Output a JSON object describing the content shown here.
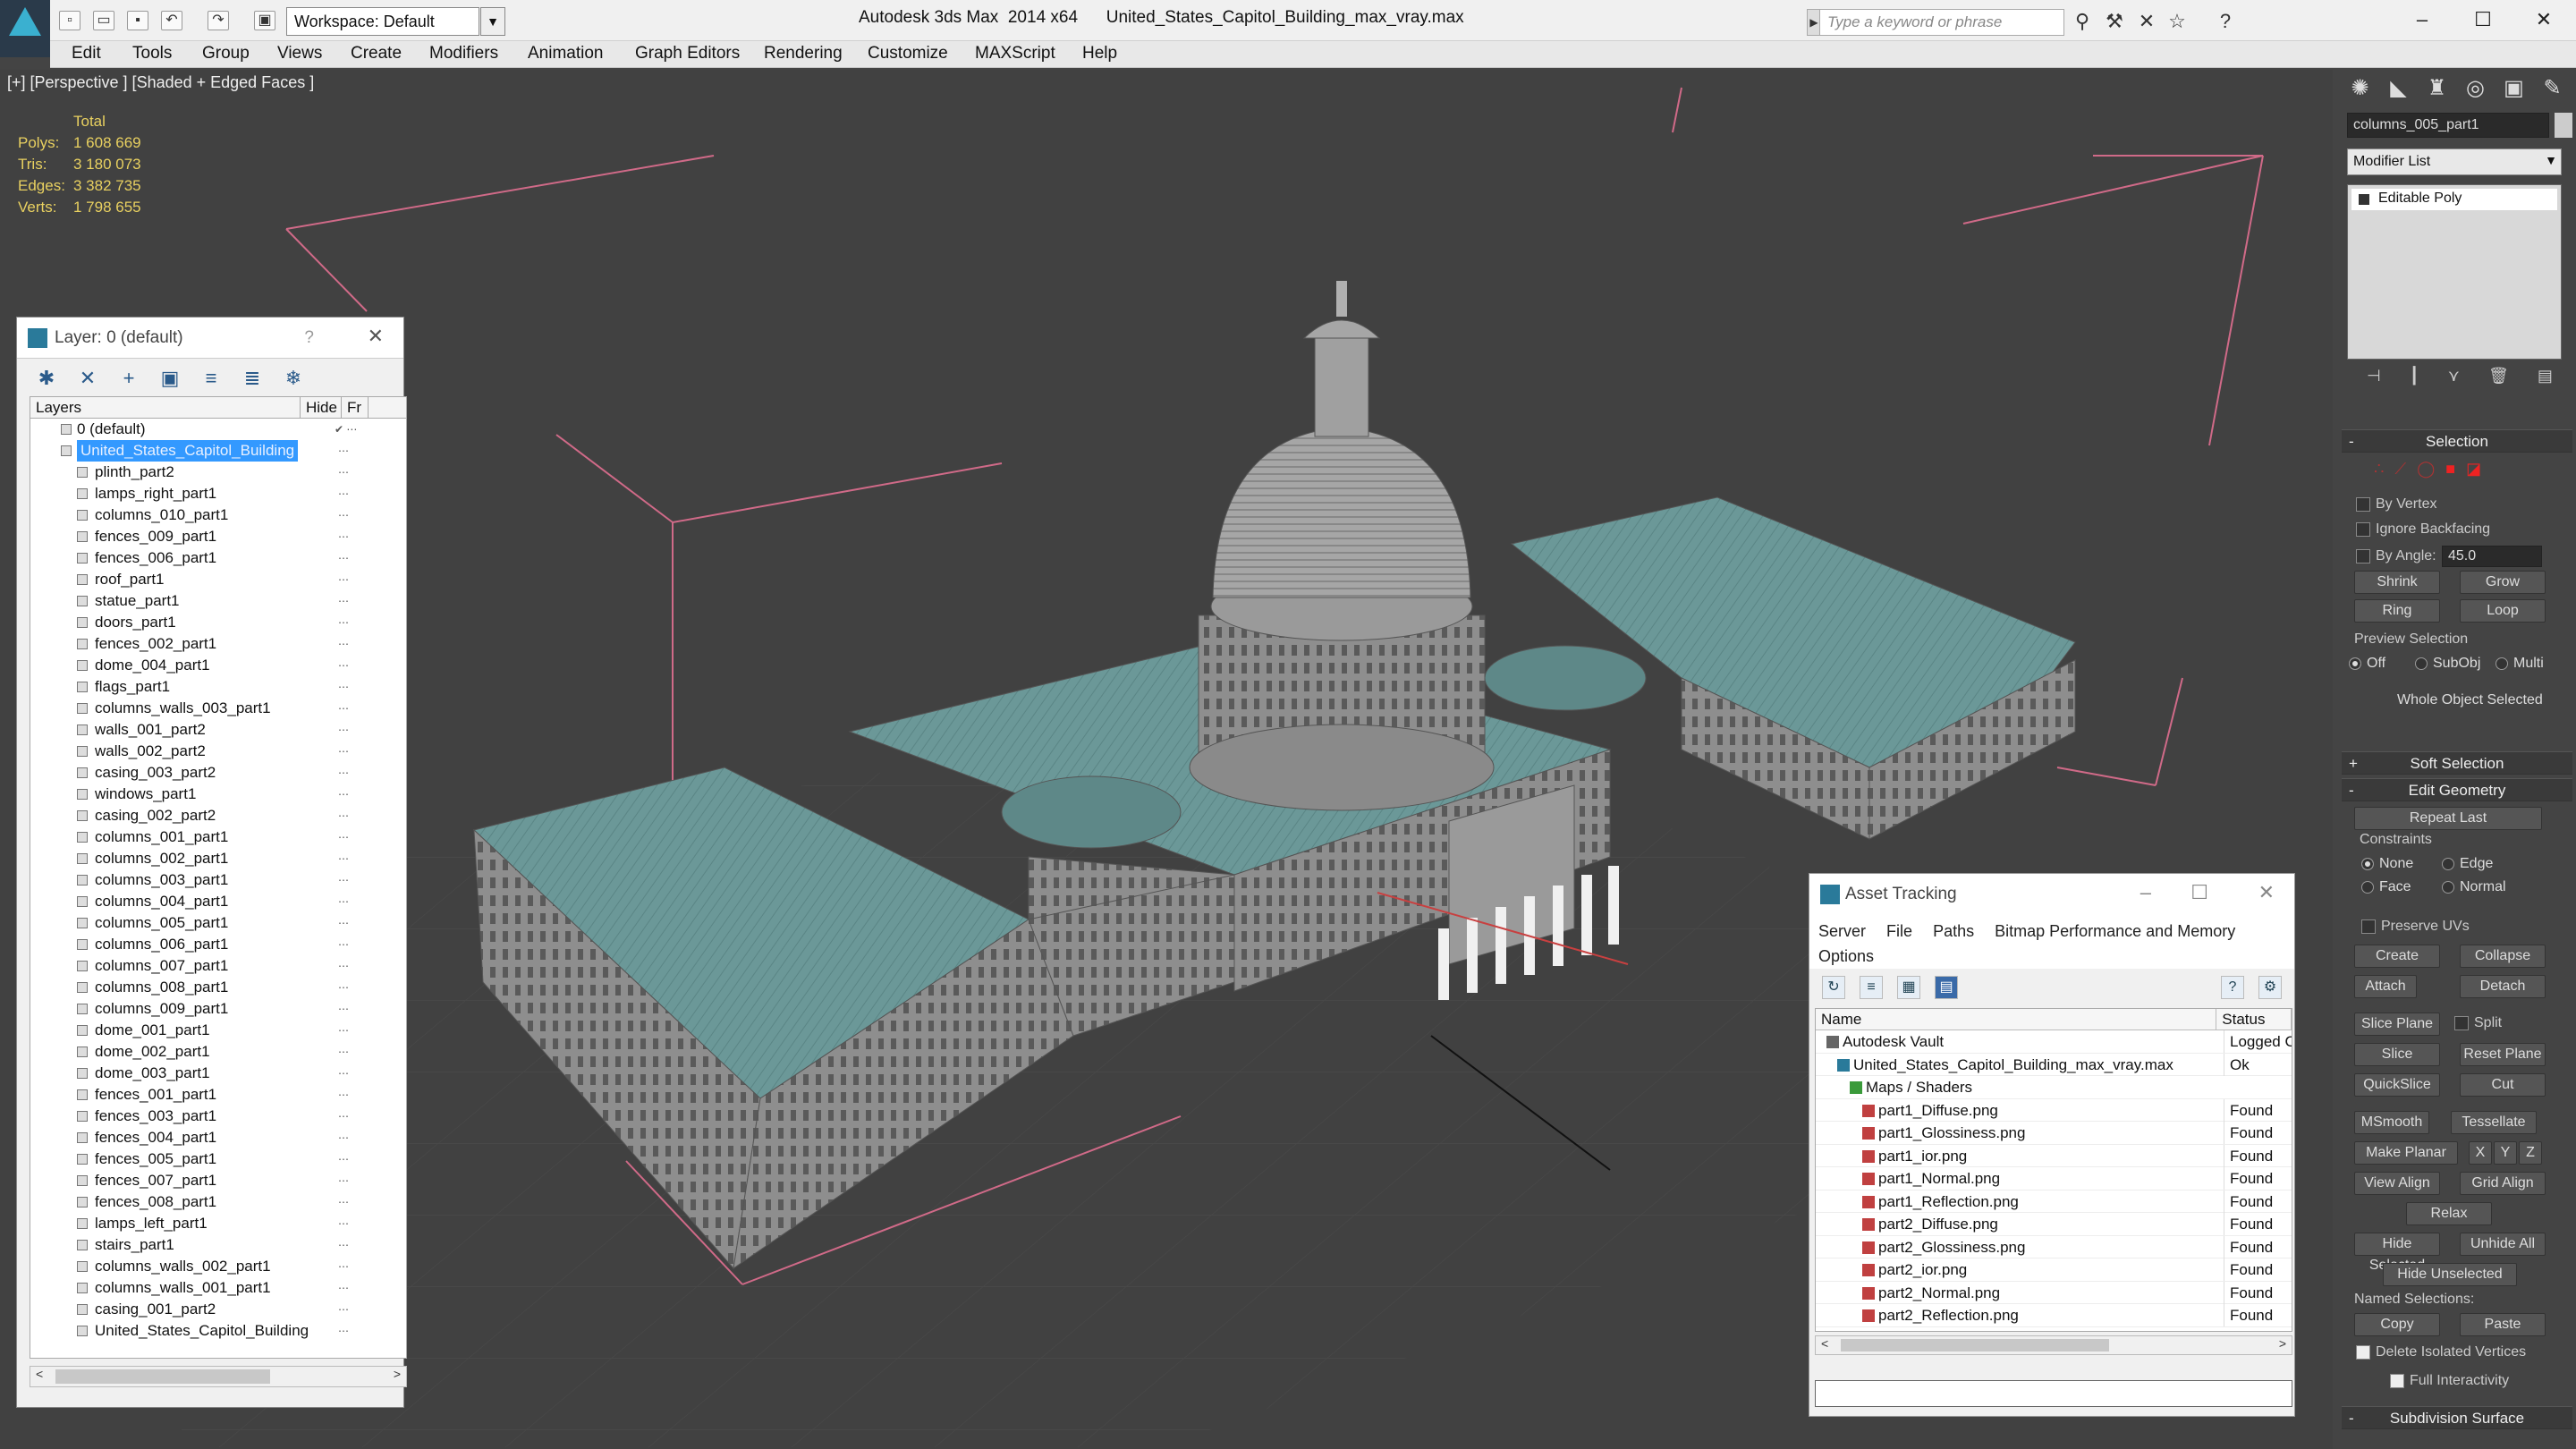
{
  "app": {
    "title": "Autodesk 3ds Max  2014 x64",
    "file": "United_States_Capitol_Building_max_vray.max",
    "workspace": "Workspace: Default",
    "search_placeholder": "Type a keyword or phrase"
  },
  "menu": [
    "Edit",
    "Tools",
    "Group",
    "Views",
    "Create",
    "Modifiers",
    "Animation",
    "Graph Editors",
    "Rendering",
    "Customize",
    "MAXScript",
    "Help"
  ],
  "viewport": {
    "label": "[+] [Perspective ] [Shaded + Edged Faces ]",
    "stats": {
      "header": "Total",
      "rows": [
        {
          "k": "Polys:",
          "v": "1 608 669"
        },
        {
          "k": "Tris:",
          "v": "3 180 073"
        },
        {
          "k": "Edges:",
          "v": "3 382 735"
        },
        {
          "k": "Verts:",
          "v": "1 798 655"
        }
      ]
    }
  },
  "layer_panel": {
    "title": "Layer: 0 (default)",
    "help": "?",
    "col_layers": "Layers",
    "col_hide": "Hide",
    "col_fr": "Fr",
    "layers": [
      {
        "name": "0 (default)",
        "hide": "",
        "type": "layer"
      },
      {
        "name": "United_States_Capitol_Building",
        "hide": "",
        "type": "layer",
        "selected": true
      },
      {
        "name": "plinth_part2"
      },
      {
        "name": "lamps_right_part1"
      },
      {
        "name": "columns_010_part1"
      },
      {
        "name": "fences_009_part1"
      },
      {
        "name": "fences_006_part1"
      },
      {
        "name": "roof_part1"
      },
      {
        "name": "statue_part1"
      },
      {
        "name": "doors_part1"
      },
      {
        "name": "fences_002_part1"
      },
      {
        "name": "dome_004_part1"
      },
      {
        "name": "flags_part1"
      },
      {
        "name": "columns_walls_003_part1"
      },
      {
        "name": "walls_001_part2"
      },
      {
        "name": "walls_002_part2"
      },
      {
        "name": "casing_003_part2"
      },
      {
        "name": "windows_part1"
      },
      {
        "name": "casing_002_part2"
      },
      {
        "name": "columns_001_part1"
      },
      {
        "name": "columns_002_part1"
      },
      {
        "name": "columns_003_part1"
      },
      {
        "name": "columns_004_part1"
      },
      {
        "name": "columns_005_part1"
      },
      {
        "name": "columns_006_part1"
      },
      {
        "name": "columns_007_part1"
      },
      {
        "name": "columns_008_part1"
      },
      {
        "name": "columns_009_part1"
      },
      {
        "name": "dome_001_part1"
      },
      {
        "name": "dome_002_part1"
      },
      {
        "name": "dome_003_part1"
      },
      {
        "name": "fences_001_part1"
      },
      {
        "name": "fences_003_part1"
      },
      {
        "name": "fences_004_part1"
      },
      {
        "name": "fences_005_part1"
      },
      {
        "name": "fences_007_part1"
      },
      {
        "name": "fences_008_part1"
      },
      {
        "name": "lamps_left_part1"
      },
      {
        "name": "stairs_part1"
      },
      {
        "name": "columns_walls_002_part1"
      },
      {
        "name": "columns_walls_001_part1"
      },
      {
        "name": "casing_001_part2"
      },
      {
        "name": "United_States_Capitol_Building"
      }
    ]
  },
  "command_panel": {
    "object_name": "columns_005_part1",
    "modifier_list": "Modifier List",
    "stack": [
      "Editable Poly"
    ],
    "selection": {
      "title": "Selection",
      "by_vertex": "By Vertex",
      "ignore_backfacing": "Ignore Backfacing",
      "by_angle": "By Angle:",
      "angle": "45.0",
      "shrink": "Shrink",
      "grow": "Grow",
      "ring": "Ring",
      "loop": "Loop",
      "preview": "Preview Selection",
      "off": "Off",
      "subobj": "SubObj",
      "multi": "Multi",
      "whole": "Whole Object Selected"
    },
    "soft_selection": "Soft Selection",
    "edit_geometry": {
      "title": "Edit Geometry",
      "repeat_last": "Repeat Last",
      "constraints": "Constraints",
      "none": "None",
      "edge": "Edge",
      "face": "Face",
      "normal": "Normal",
      "preserve_uvs": "Preserve UVs",
      "create": "Create",
      "collapse": "Collapse",
      "attach": "Attach",
      "detach": "Detach",
      "slice_plane": "Slice Plane",
      "split": "Split",
      "slice": "Slice",
      "reset_plane": "Reset Plane",
      "quickslice": "QuickSlice",
      "cut": "Cut",
      "msmooth": "MSmooth",
      "tessellate": "Tessellate",
      "make_planar": "Make Planar",
      "x": "X",
      "y": "Y",
      "z": "Z",
      "view_align": "View Align",
      "grid_align": "Grid Align",
      "relax": "Relax",
      "hide_selected": "Hide Selected",
      "unhide_all": "Unhide All",
      "hide_unselected": "Hide Unselected",
      "named_selections": "Named Selections:",
      "copy": "Copy",
      "paste": "Paste",
      "delete_isolated": "Delete Isolated Vertices",
      "full_interactivity": "Full Interactivity"
    },
    "subdivision_surface": "Subdivision Surface"
  },
  "asset_tracking": {
    "title": "Asset Tracking",
    "menu": [
      "Server",
      "File",
      "Paths",
      "Bitmap Performance and Memory",
      "Options"
    ],
    "col_name": "Name",
    "col_status": "Status",
    "rows": [
      {
        "name": "Autodesk Vault",
        "status": "Logged C",
        "indent": 30,
        "type": "vault"
      },
      {
        "name": "United_States_Capitol_Building_max_vray.max",
        "status": "Ok",
        "indent": 42,
        "type": "max"
      },
      {
        "name": "Maps / Shaders",
        "status": "",
        "indent": 56,
        "type": "folder"
      },
      {
        "name": "part1_Diffuse.png",
        "status": "Found",
        "indent": 70,
        "type": "png"
      },
      {
        "name": "part1_Glossiness.png",
        "status": "Found",
        "indent": 70,
        "type": "png"
      },
      {
        "name": "part1_ior.png",
        "status": "Found",
        "indent": 70,
        "type": "png"
      },
      {
        "name": "part1_Normal.png",
        "status": "Found",
        "indent": 70,
        "type": "png"
      },
      {
        "name": "part1_Reflection.png",
        "status": "Found",
        "indent": 70,
        "type": "png"
      },
      {
        "name": "part2_Diffuse.png",
        "status": "Found",
        "indent": 70,
        "type": "png"
      },
      {
        "name": "part2_Glossiness.png",
        "status": "Found",
        "indent": 70,
        "type": "png"
      },
      {
        "name": "part2_ior.png",
        "status": "Found",
        "indent": 70,
        "type": "png"
      },
      {
        "name": "part2_Normal.png",
        "status": "Found",
        "indent": 70,
        "type": "png"
      },
      {
        "name": "part2_Reflection.png",
        "status": "Found",
        "indent": 70,
        "type": "png"
      }
    ]
  },
  "colors": {
    "viewport_bg": "#414141",
    "stats_yellow": "#e8d060",
    "selection_blue": "#3399ff",
    "bbox_pink": "#d06a88",
    "roof_teal": "#6a9a9a",
    "building_grey": "#9a9a9a"
  }
}
